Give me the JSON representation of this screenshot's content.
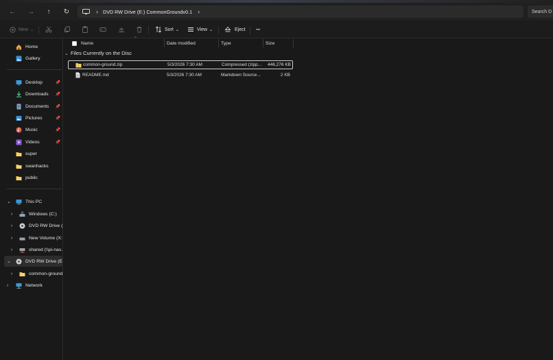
{
  "address": {
    "crumb": "DVD RW Drive (E:) CommonGroundv0.1"
  },
  "search": {
    "placeholder": "Search D"
  },
  "commands": {
    "new_label": "New",
    "sort_label": "Sort",
    "view_label": "View",
    "eject_label": "Eject",
    "more_label": "···"
  },
  "sidebar": {
    "home": "Home",
    "gallery": "Gallery",
    "desktop": "Desktop",
    "downloads": "Downloads",
    "documents": "Documents",
    "pictures": "Pictures",
    "music": "Music",
    "videos": "Videos",
    "super": "super",
    "swanhacks": "swanhacks",
    "public": "public",
    "this_pc": "This PC",
    "windows_c": "Windows (C:)",
    "dvd_e": "DVD RW Drive (E:)",
    "new_volume": "New Volume (X:)",
    "shared": "shared (\\\\pi-nas.l",
    "dvd_e_selected": "DVD RW Drive (E:) C",
    "common_ground": "common-ground",
    "network": "Network"
  },
  "columns": {
    "name": "Name",
    "date_modified": "Date modified",
    "type": "Type",
    "size": "Size"
  },
  "group": {
    "label": "Files Currently on the Disc"
  },
  "files": [
    {
      "name": "common-ground.zip",
      "date": "5/3/2026 7:30 AM",
      "type": "Compressed (zipp...",
      "size": "446,276 KB"
    },
    {
      "name": "README.md",
      "date": "5/3/2026 7:30 AM",
      "type": "Markdown Source...",
      "size": "2 KB"
    }
  ]
}
